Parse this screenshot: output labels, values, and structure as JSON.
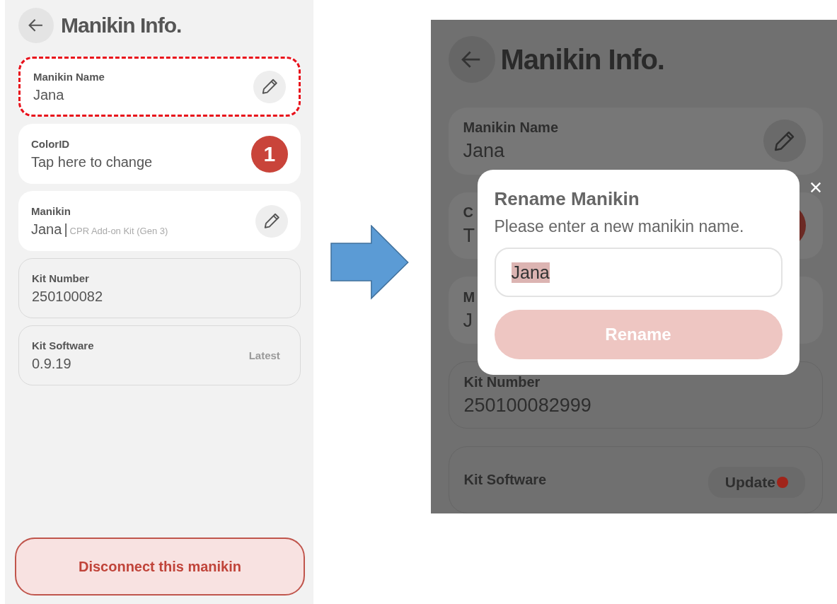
{
  "screens": [
    {
      "title": "Manikin Info.",
      "dimmed": false,
      "fields": [
        {
          "kind": "editable",
          "label": "Manikin Name",
          "value": "Jana",
          "highlighted": true
        },
        {
          "kind": "badge",
          "label": "ColorID",
          "value": "Tap here to change",
          "badge": "1"
        },
        {
          "kind": "editable",
          "label": "Manikin",
          "value": "Jana",
          "separator": "|",
          "detail": "CPR Add-on Kit (Gen 3)"
        },
        {
          "kind": "readonly",
          "label": "Kit Number",
          "value": "250100082"
        },
        {
          "kind": "readonly",
          "label": "Kit Software",
          "value": "0.9.19",
          "status": "Latest"
        }
      ],
      "footer_button": "Disconnect this manikin"
    },
    {
      "title": "Manikin Info.",
      "dimmed": true,
      "fields": [
        {
          "kind": "editable",
          "label": "Manikin Name",
          "value": "Jana",
          "highlighted": false
        },
        {
          "kind": "covered",
          "label": "C",
          "value": "T",
          "badge_dot": true
        },
        {
          "kind": "covered",
          "label": "M",
          "value": "J"
        },
        {
          "kind": "readonly",
          "label": "Kit Number",
          "value": "250100082999"
        },
        {
          "kind": "update",
          "label": "Kit Software",
          "action": "Update"
        }
      ],
      "dialog": {
        "title": "Rename Manikin",
        "message": "Please enter a new manikin name.",
        "input_value": "Jana",
        "text_selected": true,
        "button": "Rename",
        "button_disabled": true
      }
    }
  ]
}
